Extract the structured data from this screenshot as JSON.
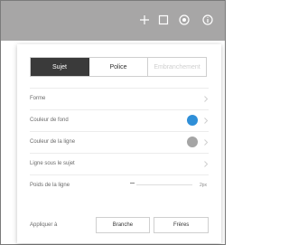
{
  "toolbar": {
    "icons": [
      "plus-icon",
      "square-icon",
      "color-wheel-icon",
      "info-icon"
    ]
  },
  "tabs": [
    {
      "label": "Sujet",
      "active": true
    },
    {
      "label": "Police",
      "active": false
    },
    {
      "label": "Embranchement",
      "active": false
    }
  ],
  "rows": {
    "forme": {
      "label": "Forme"
    },
    "couleur_fond": {
      "label": "Couleur de fond",
      "color": "#2f8fd8"
    },
    "couleur_ligne": {
      "label": "Couleur de la ligne",
      "color": "#a5a5a5"
    },
    "ligne_sous": {
      "label": "Ligne sous le sujet"
    },
    "poids": {
      "label": "Poids de la ligne",
      "value": "2px"
    }
  },
  "apply": {
    "label": "Appliquer à",
    "buttons": [
      "Branche",
      "Frères"
    ]
  }
}
